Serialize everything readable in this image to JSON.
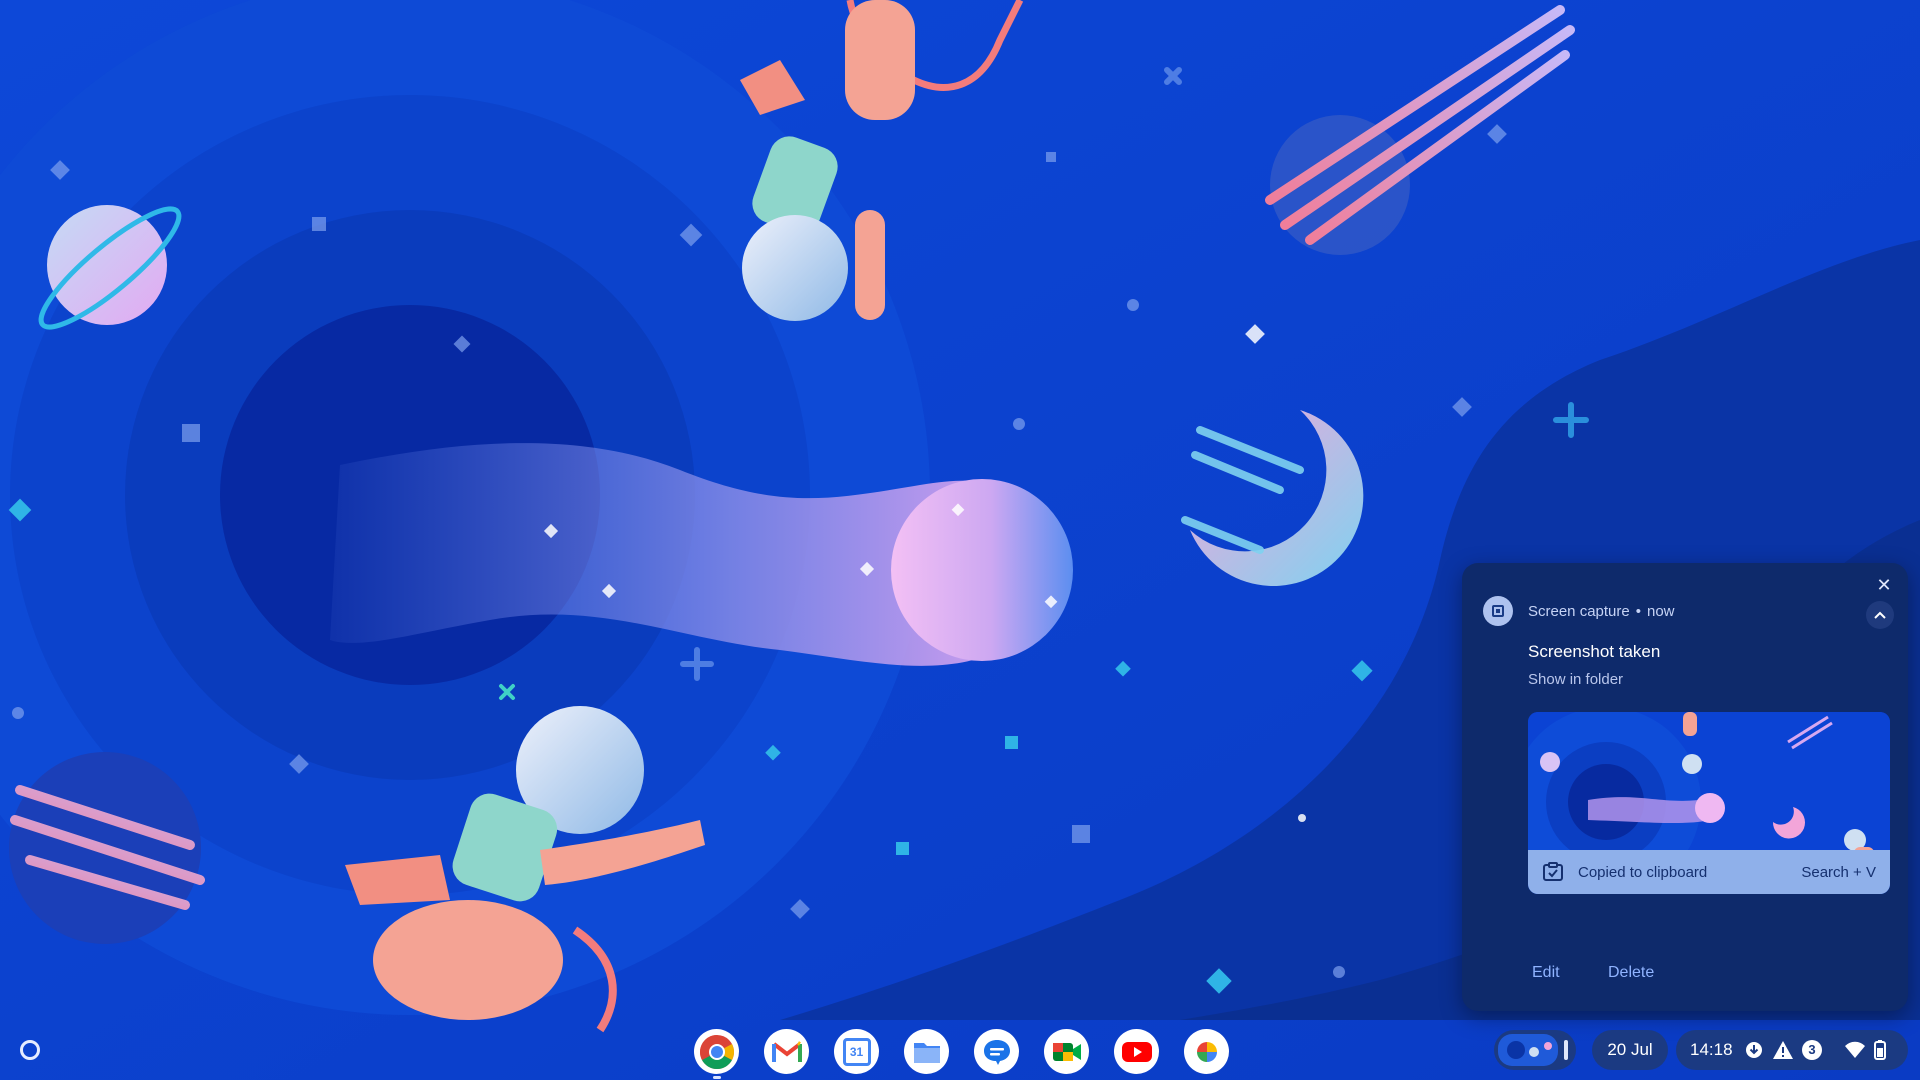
{
  "notification": {
    "app_name": "Screen capture",
    "separator": "•",
    "time": "now",
    "title": "Screenshot taken",
    "body": "Show in folder",
    "clipboard_label": "Copied to clipboard",
    "clipboard_shortcut": "Search + V",
    "actions": [
      "Edit",
      "Delete"
    ],
    "close_glyph": "✕"
  },
  "shelf": {
    "apps": [
      {
        "name": "chrome-icon"
      },
      {
        "name": "gmail-icon"
      },
      {
        "name": "calendar-icon",
        "label": "31"
      },
      {
        "name": "files-icon"
      },
      {
        "name": "messages-icon"
      },
      {
        "name": "meet-icon"
      },
      {
        "name": "youtube-icon"
      },
      {
        "name": "photos-icon"
      }
    ],
    "date": "20 Jul",
    "time": "14:18",
    "notification_count": "3"
  },
  "colors": {
    "wallpaper_base": "#0b3fd1",
    "notification_bg": "#0e2a6b",
    "accent": "#8fb3ff",
    "clipboard_bar": "#8fb0ea"
  }
}
